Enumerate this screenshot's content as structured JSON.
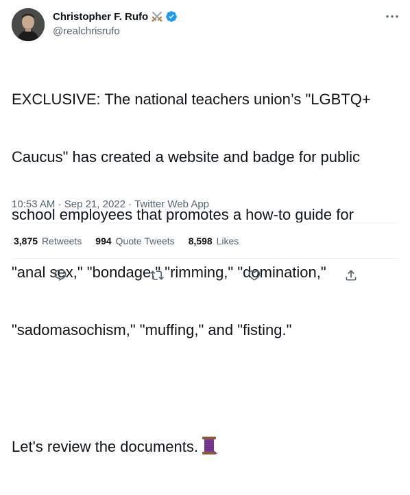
{
  "author": {
    "name": "Christopher F. Rufo",
    "handle": "@realchrisrufo",
    "name_emoji_icon": "crossed-swords-icon",
    "verified_icon": "verified-badge-icon",
    "verified_color": "#1d9bf0"
  },
  "tweet": {
    "lines": [
      "EXCLUSIVE: The national teachers union’s \"LGBTQ+",
      "Caucus\" has created a website and badge for public",
      "school employees that promotes a how-to guide for",
      "\"anal sex,\" \"bondage,\" \"rimming,\" \"domination,\"",
      "\"sadomasochism,\" \"muffing,\" and \"fisting.\""
    ],
    "second_paragraph": "Let's review the documents.",
    "trailing_emoji_icon": "thread-spool-icon"
  },
  "meta": {
    "time": "10:53 AM",
    "separator": "·",
    "date": "Sep 21, 2022",
    "source": "Twitter Web App"
  },
  "stats": [
    {
      "count": "3,875",
      "label": "Retweets"
    },
    {
      "count": "994",
      "label": "Quote Tweets"
    },
    {
      "count": "8,598",
      "label": "Likes"
    }
  ],
  "actions": [
    {
      "name": "reply",
      "icon": "reply-icon"
    },
    {
      "name": "retweet",
      "icon": "retweet-icon"
    },
    {
      "name": "like",
      "icon": "heart-icon"
    },
    {
      "name": "share",
      "icon": "share-icon"
    }
  ],
  "colors": {
    "text": "#0f1419",
    "secondary": "#536471",
    "divider": "#eff3f4",
    "icon": "#536471"
  }
}
